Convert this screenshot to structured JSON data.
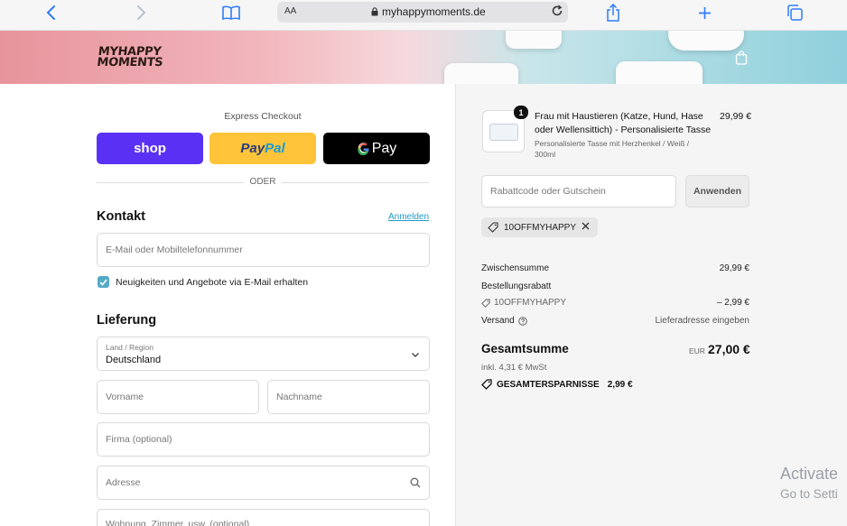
{
  "browser": {
    "text_size_label": "AA",
    "url": "myhappymoments.de"
  },
  "brand": {
    "logo_line1": "MYHAPPY",
    "logo_line2": "MOMENTS"
  },
  "express": {
    "title": "Express Checkout",
    "shop_label": "shop",
    "paypal_part1": "Pay",
    "paypal_part2": "Pal",
    "gpay_label": "Pay",
    "divider": "ODER"
  },
  "contact": {
    "title": "Kontakt",
    "login_link": "Anmelden",
    "email_placeholder": "E-Mail oder Mobiltelefonnummer",
    "newsletter_label": "Neuigkeiten und Angebote via E-Mail erhalten",
    "newsletter_checked": true
  },
  "delivery": {
    "title": "Lieferung",
    "country_label": "Land / Region",
    "country_value": "Deutschland",
    "first_name": "Vorname",
    "last_name": "Nachname",
    "company": "Firma (optional)",
    "address": "Adresse",
    "apartment": "Wohnung, Zimmer, usw. (optional)"
  },
  "cart": {
    "quantity": "1",
    "product_title": "Frau mit Haustieren (Katze, Hund, Hase oder Wellensittich) - Personalisierte Tasse",
    "product_variant": "Personalisierte Tasse mit Herzhenkel / Weiß / 300ml",
    "product_price": "29,99 €",
    "discount_placeholder": "Rabattcode oder Gutschein",
    "apply_label": "Anwenden",
    "applied_code": "10OFFMYHAPPY",
    "subtotal_label": "Zwischensumme",
    "subtotal_value": "29,99 €",
    "order_discount_label": "Bestellungsrabatt",
    "discount_code": "10OFFMYHAPPY",
    "discount_value": "– 2,99 €",
    "shipping_label": "Versand",
    "shipping_value": "Lieferadresse eingeben",
    "total_label": "Gesamtsumme",
    "currency": "EUR",
    "total_value": "27,00 €",
    "tax_note": "inkl. 4,31 € MwSt",
    "savings_label": "GESAMTERSPARNISSE",
    "savings_value": "2,99 €"
  },
  "os_overlay": {
    "line1": "Activate",
    "line2": "Go to Setti"
  },
  "colors": {
    "accent": "#54a9c5",
    "shop": "#5a31f4",
    "paypal": "#ffc439",
    "gpay": "#000000"
  }
}
